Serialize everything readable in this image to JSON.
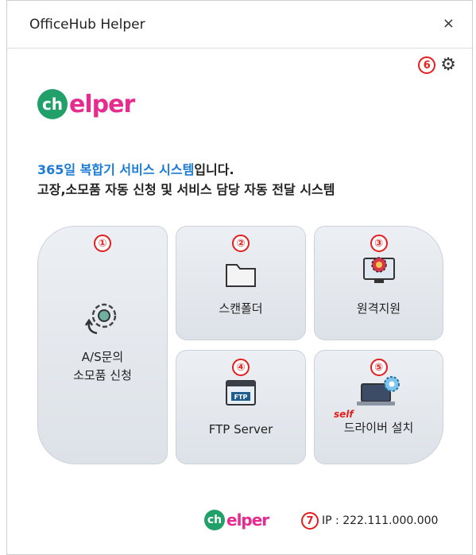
{
  "window": {
    "title": "OfficeHub Helper",
    "close_glyph": "×"
  },
  "settings": {
    "marker": "6",
    "icon": "gear-icon"
  },
  "logo": {
    "glyph": "ch",
    "text": "elper"
  },
  "intro": {
    "line1_highlight": "365일 복합기 서비스 시스템",
    "line1_rest": "입니다.",
    "line2": "고장,소모품 자동 신청 및 서비스 담당 자동 전달 시스템"
  },
  "tiles": {
    "as": {
      "marker": "①",
      "label_line1": "A/S문의",
      "label_line2": "소모품 신청",
      "icon": "gear-cycle-icon"
    },
    "scan": {
      "marker": "②",
      "label": "스캔폴더",
      "icon": "folder-icon"
    },
    "remote": {
      "marker": "③",
      "label": "원격지원",
      "icon": "monitor-gear-icon"
    },
    "ftp": {
      "marker": "④",
      "label": "FTP Server",
      "icon": "ftp-window-icon",
      "icon_text": "FTP"
    },
    "driver": {
      "marker": "⑤",
      "label": "드라이버 설치",
      "self_tag": "self",
      "icon": "laptop-gear-icon"
    }
  },
  "footer": {
    "ip_marker": "7",
    "ip_text": "IP : 222.111.000.000"
  },
  "colors": {
    "accent_blue": "#1b7bd6",
    "marker_red": "#e41e1e",
    "logo_green": "#21a06a",
    "logo_pink": "#e62c8e"
  }
}
